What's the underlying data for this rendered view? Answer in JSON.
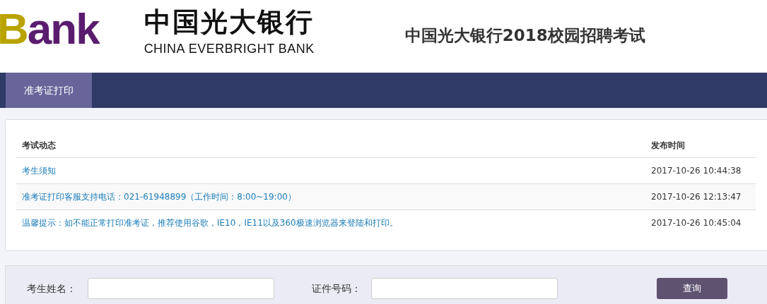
{
  "header": {
    "logo_wordmark": "Bank",
    "bank_name_cn": "中国光大银行",
    "bank_name_en": "CHINA EVERBRIGHT BANK",
    "page_title": "中国光大银行2018校园招聘考试"
  },
  "nav": {
    "tabs": [
      {
        "label": "准考证打印",
        "selected": true
      }
    ]
  },
  "table": {
    "columns": [
      "考试动态",
      "发布时间"
    ],
    "rows": [
      {
        "title": "考生须知",
        "time": "2017-10-26 10:44:38"
      },
      {
        "title": "准考证打印客服支持电话：021-61948899（工作时间：8:00~19:00）",
        "time": "2017-10-26 12:13:47"
      },
      {
        "title": "温馨提示：如不能正常打印准考证，推荐使用谷歌，IE10，IE11以及360极速浏览器来登陆和打印。",
        "time": "2017-10-26 10:45:04"
      }
    ]
  },
  "search": {
    "fields": [
      {
        "label": "考生姓名："
      },
      {
        "label": "证件号码："
      }
    ],
    "button": "查询"
  }
}
